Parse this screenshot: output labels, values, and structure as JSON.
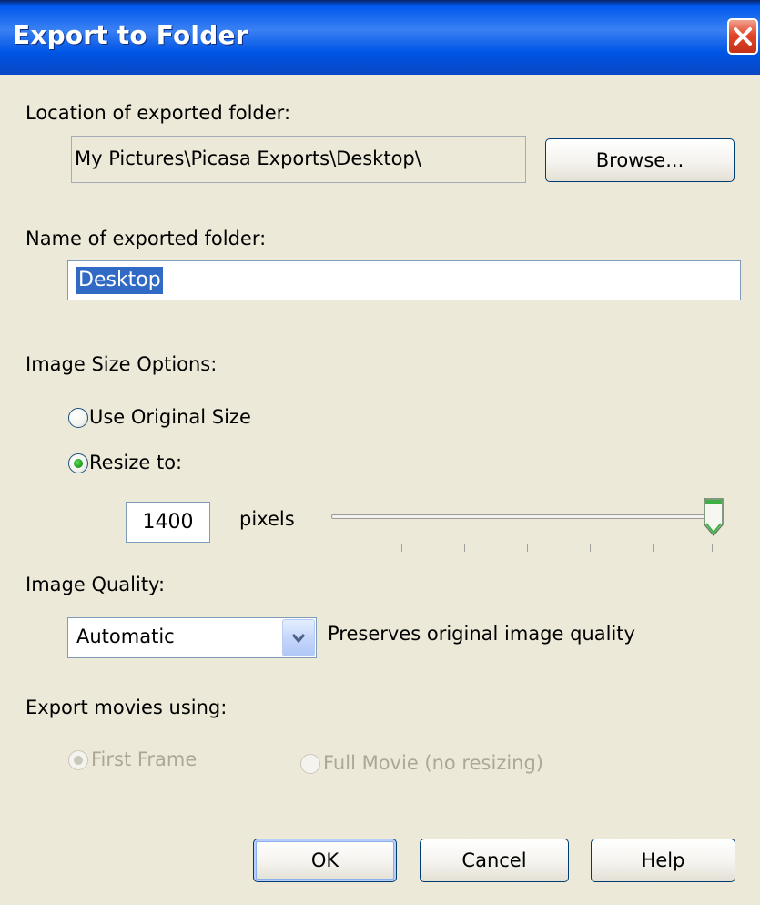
{
  "window": {
    "title": "Export to Folder"
  },
  "location": {
    "label": "Location of exported folder:",
    "value": "My Pictures\\Picasa Exports\\Desktop\\",
    "browse_label": "Browse..."
  },
  "name": {
    "label": "Name of exported folder:",
    "value": "Desktop"
  },
  "size": {
    "label": "Image Size Options:",
    "option_original": "Use Original Size",
    "option_resize": "Resize to:",
    "selected": "Resize to:",
    "pixels_value": "1400",
    "pixels_unit": "pixels",
    "slider_fraction": 1.0
  },
  "quality": {
    "label": "Image Quality:",
    "selected": "Automatic",
    "description": "Preserves original image quality"
  },
  "movies": {
    "label": "Export movies using:",
    "option_first": "First Frame",
    "option_full": "Full Movie (no resizing)",
    "selected": "First Frame",
    "enabled": false
  },
  "buttons": {
    "ok": "OK",
    "cancel": "Cancel",
    "help": "Help"
  },
  "colors": {
    "title_bar": "#0055E5",
    "dialog_bg": "#ECE9D8",
    "selection": "#316AC5",
    "close_red": "#E2462A",
    "radio_green": "#21A121"
  }
}
